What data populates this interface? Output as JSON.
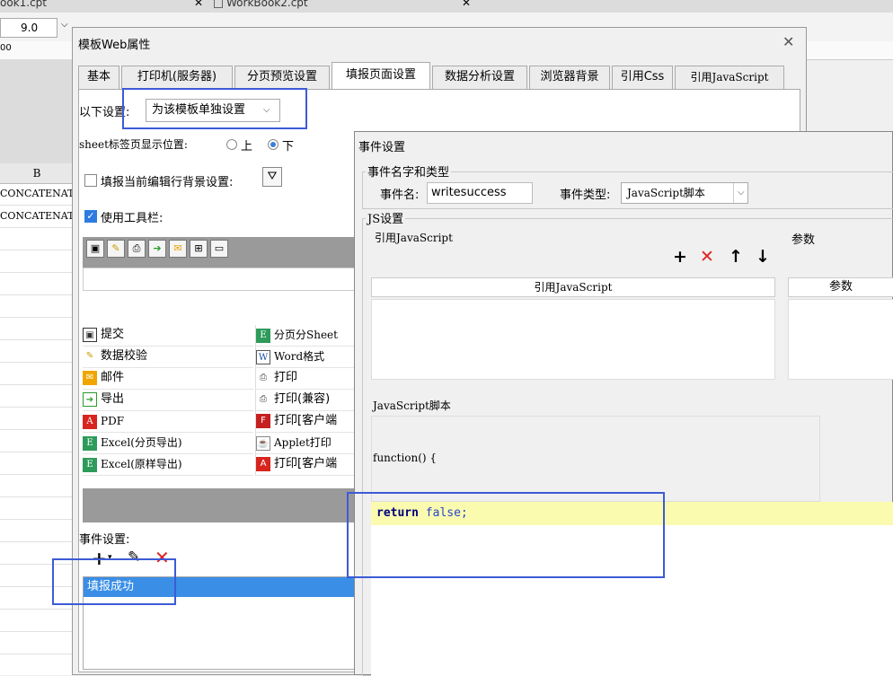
{
  "background_app": {
    "tabs": [
      "ook1.cpt",
      "WorkBook2.cpt"
    ],
    "font_size": "9.0",
    "column_header": "B",
    "cells": [
      "CONCATENATE",
      "CONCATENATE"
    ]
  },
  "main_dialog": {
    "title": "模板Web属性",
    "tabs": [
      "基本",
      "打印机(服务器)",
      "分页预览设置",
      "填报页面设置",
      "数据分析设置",
      "浏览器背景",
      "引用Css",
      "引用JavaScript"
    ],
    "settings_label": "以下设置:",
    "settings_value": "为该模板单独设置",
    "sheet_label": "sheet标签页显示位置:",
    "sheet_options": [
      "上",
      "下"
    ],
    "bg_setting_label": "填报当前编辑行背景设置:",
    "use_toolbar_label": "使用工具栏:",
    "buttons_left": [
      "提交",
      "数据校验",
      "邮件",
      "导出",
      "PDF",
      "Excel(分页导出)",
      "Excel(原样导出)"
    ],
    "buttons_right": [
      "分页分Sheet",
      "Word格式",
      "打印",
      "打印(兼容)",
      "打印[客户端",
      "Applet打印",
      "打印[客户端"
    ],
    "event_settings_label": "事件设置:",
    "event_item": "填报成功"
  },
  "event_dialog": {
    "title": "事件设置",
    "group_name_type": "事件名字和类型",
    "event_name_label": "事件名:",
    "event_name_value": "writesuccess",
    "event_type_label": "事件类型:",
    "event_type_value": "JavaScript脚本",
    "group_js": "JS设置",
    "ref_js_label": "引用JavaScript",
    "params_label": "参数",
    "table_col_js": "引用JavaScript",
    "table_col_params": "参数",
    "script_label": "JavaScript脚本",
    "function_sig": "function() {",
    "code_kw": "return",
    "code_rest": "false;"
  },
  "colors": {
    "accent": "#3a8ee6",
    "highlight": "#3d5bd6",
    "delete": "#e02020"
  }
}
